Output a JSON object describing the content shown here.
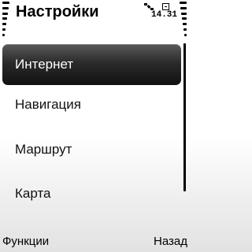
{
  "header": {
    "title": "Настройки",
    "clock": "14.31",
    "icons": {
      "signal": "signal-strength-icon",
      "battery": "battery-level-icon",
      "satellite": "satellite-icon",
      "message": "message-icon"
    }
  },
  "menu": {
    "items": [
      {
        "label": "Интернет",
        "selected": true
      },
      {
        "label": "Навигация",
        "selected": false
      },
      {
        "label": "Маршрут",
        "selected": false
      },
      {
        "label": "Карта",
        "selected": false
      }
    ]
  },
  "softkeys": {
    "left": "Функции",
    "right": "Назад"
  },
  "colors": {
    "selected_background": "#1e1e1e",
    "selected_text": "#ffffff",
    "text": "#111111"
  }
}
